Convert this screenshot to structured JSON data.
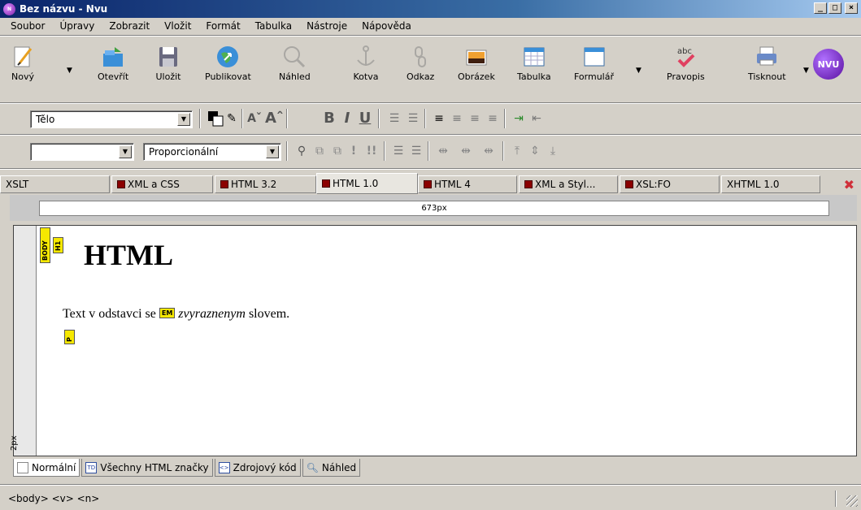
{
  "window": {
    "title": "Bez názvu - Nvu",
    "app_icon": "nvu-icon"
  },
  "menu": [
    "Soubor",
    "Úpravy",
    "Zobrazit",
    "Vložit",
    "Formát",
    "Tabulka",
    "Nástroje",
    "Nápověda"
  ],
  "toolbar": {
    "buttons": [
      {
        "label": "Nový",
        "icon": "new-doc-icon"
      },
      {
        "label": "Otevřít",
        "icon": "open-icon"
      },
      {
        "label": "Uložit",
        "icon": "save-icon"
      },
      {
        "label": "Publikovat",
        "icon": "publish-icon"
      },
      {
        "label": "Náhled",
        "icon": "preview-icon"
      },
      {
        "label": "Kotva",
        "icon": "anchor-icon"
      },
      {
        "label": "Odkaz",
        "icon": "link-icon"
      },
      {
        "label": "Obrázek",
        "icon": "image-icon"
      },
      {
        "label": "Tabulka",
        "icon": "table-icon"
      },
      {
        "label": "Formulář",
        "icon": "form-icon"
      },
      {
        "label": "Pravopis",
        "icon": "spellcheck-icon"
      },
      {
        "label": "Tisknout",
        "icon": "print-icon"
      }
    ],
    "brand_badge": "NVU"
  },
  "format_bar": {
    "paragraph_format": "Tělo",
    "font_select": "Proporcionální",
    "class_select": ""
  },
  "tabs": [
    "XSLT",
    "XML a CSS",
    "HTML 3.2",
    "HTML 1.0",
    "HTML 4",
    "XML a Styl...",
    "XSL:FO",
    "XHTML 1.0"
  ],
  "active_tab": "HTML 1.0",
  "ruler": {
    "width_label": "673px",
    "height_label": "2px"
  },
  "document": {
    "tags": {
      "body": "BODY",
      "h1": "H1",
      "em": "EM",
      "p": "P"
    },
    "heading": "HTML",
    "para_before": "Text v odstavci se ",
    "para_em": "zvyraznenym",
    "para_after": " slovem."
  },
  "mode_tabs": [
    "Normální",
    "Všechny HTML značky",
    "Zdrojový kód",
    "Náhled"
  ],
  "mode_tab_icons": [
    "",
    "TD",
    "<>",
    ""
  ],
  "status": {
    "path": "<body>  <v>  <n>"
  },
  "colors": {
    "title_bar": "#0a246a",
    "tag_yellow": "#f6e800",
    "close_red": "#d0303a"
  }
}
